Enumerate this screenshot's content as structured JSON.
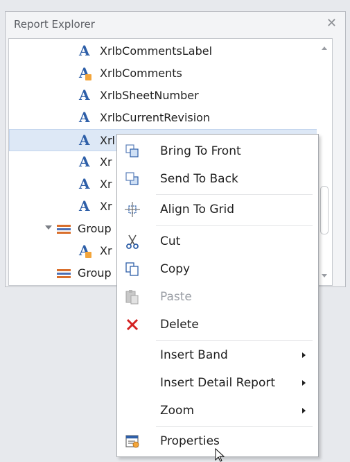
{
  "panel": {
    "title": "Report Explorer",
    "close_glyph": "✕"
  },
  "tree": {
    "items": [
      {
        "label": "XrlbCommentsLabel",
        "icon": "label-icon"
      },
      {
        "label": "XrlbComments",
        "icon": "label-locked-icon"
      },
      {
        "label": "XrlbSheetNumber",
        "icon": "label-icon"
      },
      {
        "label": "XrlbCurrentRevision",
        "icon": "label-icon"
      },
      {
        "label": "Xrl",
        "icon": "label-icon",
        "selected": true
      },
      {
        "label": "Xr",
        "icon": "label-icon"
      },
      {
        "label": "Xr",
        "icon": "label-icon"
      },
      {
        "label": "Xr",
        "icon": "label-icon"
      },
      {
        "label": "Group",
        "icon": "band-icon",
        "expanded": true
      },
      {
        "label": "Xr",
        "icon": "label-locked-icon"
      },
      {
        "label": "Group",
        "icon": "band-icon"
      }
    ]
  },
  "context_menu": {
    "items": [
      {
        "label": "Bring To Front",
        "icon": "bring-to-front-icon"
      },
      {
        "label": "Send To Back",
        "icon": "send-to-back-icon"
      },
      {
        "label": "Align To Grid",
        "icon": "align-to-grid-icon"
      },
      {
        "label": "Cut",
        "icon": "cut-icon"
      },
      {
        "label": "Copy",
        "icon": "copy-icon"
      },
      {
        "label": "Paste",
        "icon": "paste-icon",
        "disabled": true
      },
      {
        "label": "Delete",
        "icon": "delete-icon"
      },
      {
        "label": "Insert Band",
        "submenu": true
      },
      {
        "label": "Insert Detail Report",
        "submenu": true
      },
      {
        "label": "Zoom",
        "submenu": true
      },
      {
        "label": "Properties",
        "icon": "properties-icon"
      }
    ]
  },
  "colors": {
    "accent_blue": "#2e5fa8",
    "delete_red": "#d42222",
    "selection": "#dde8f6"
  }
}
